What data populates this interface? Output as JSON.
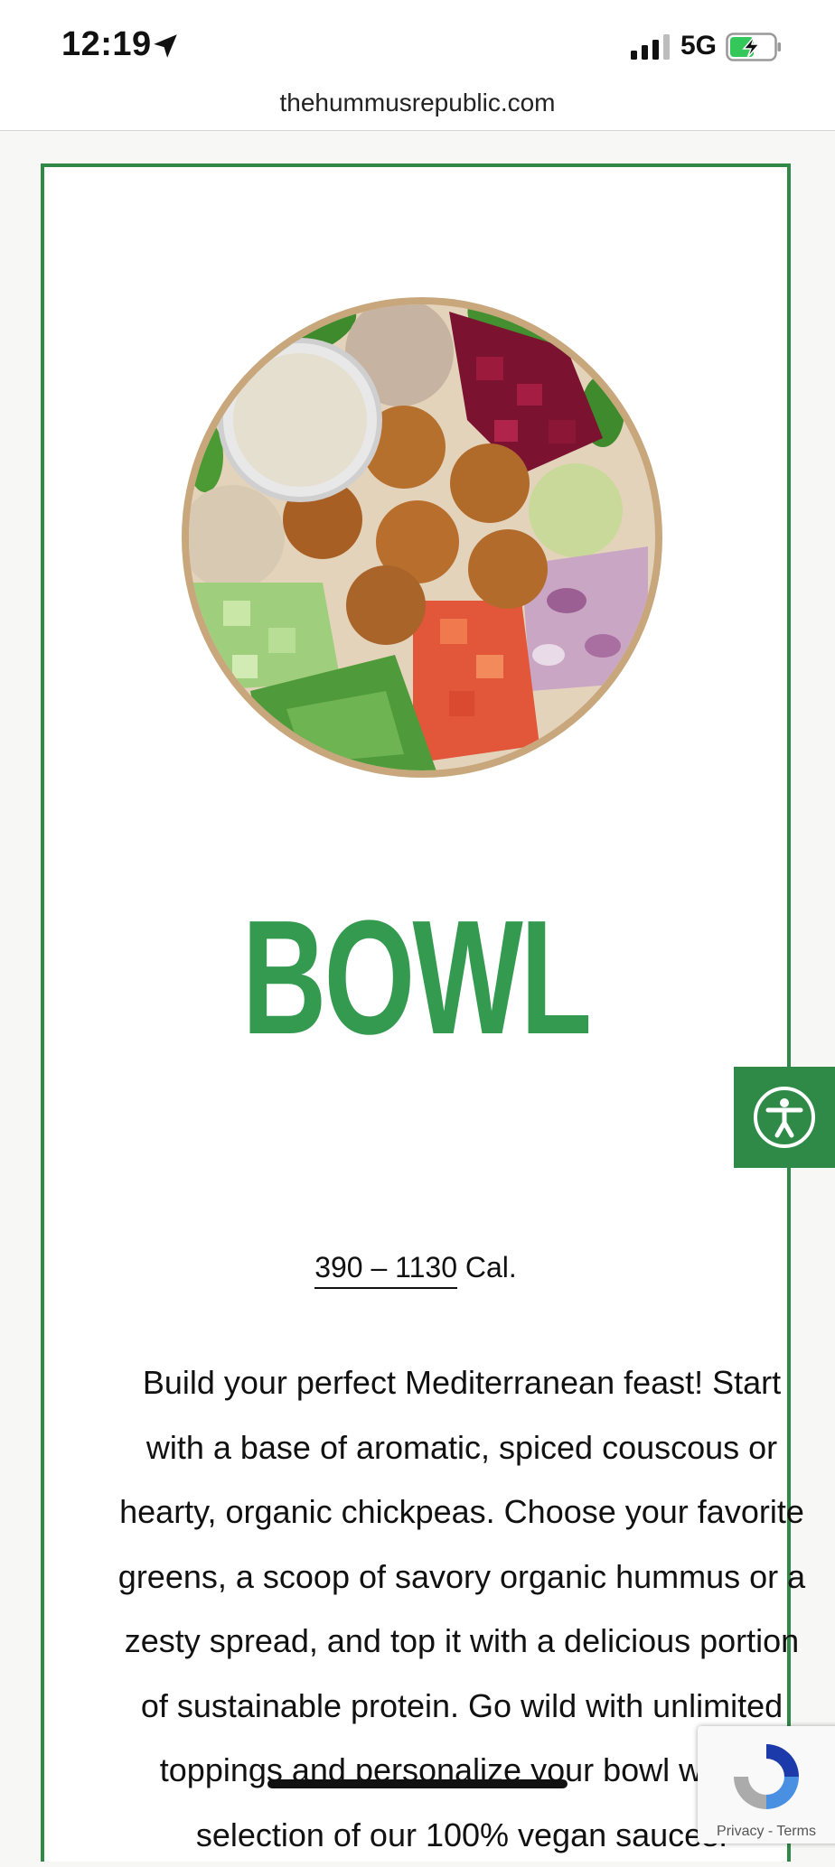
{
  "status_bar": {
    "time": "12:19",
    "network": "5G",
    "icons": [
      "location-arrow-icon",
      "signal-icon",
      "battery-charging-icon"
    ]
  },
  "browser": {
    "url": "thehummusrepublic.com"
  },
  "product": {
    "title": "BOWL",
    "calories_range": "390 – 1130",
    "calories_unit": " Cal.",
    "description": "Build your perfect Mediterranean feast! Start with a base of aromatic, spiced couscous or hearty, organic chickpeas. Choose your favorite greens, a scoop of savory organic hummus or a zesty spread, and top it with a delicious portion of sustainable protein. Go wild with unlimited toppings and personalize your bowl with a selection of our 100% vegan sauces."
  },
  "widgets": {
    "accessibility_icon": "accessibility-person-icon",
    "recaptcha_privacy": "Privacy",
    "recaptcha_separator": " - ",
    "recaptcha_terms": "Terms"
  },
  "colors": {
    "brand_green": "#349a50",
    "border_green": "#2f8a47"
  }
}
